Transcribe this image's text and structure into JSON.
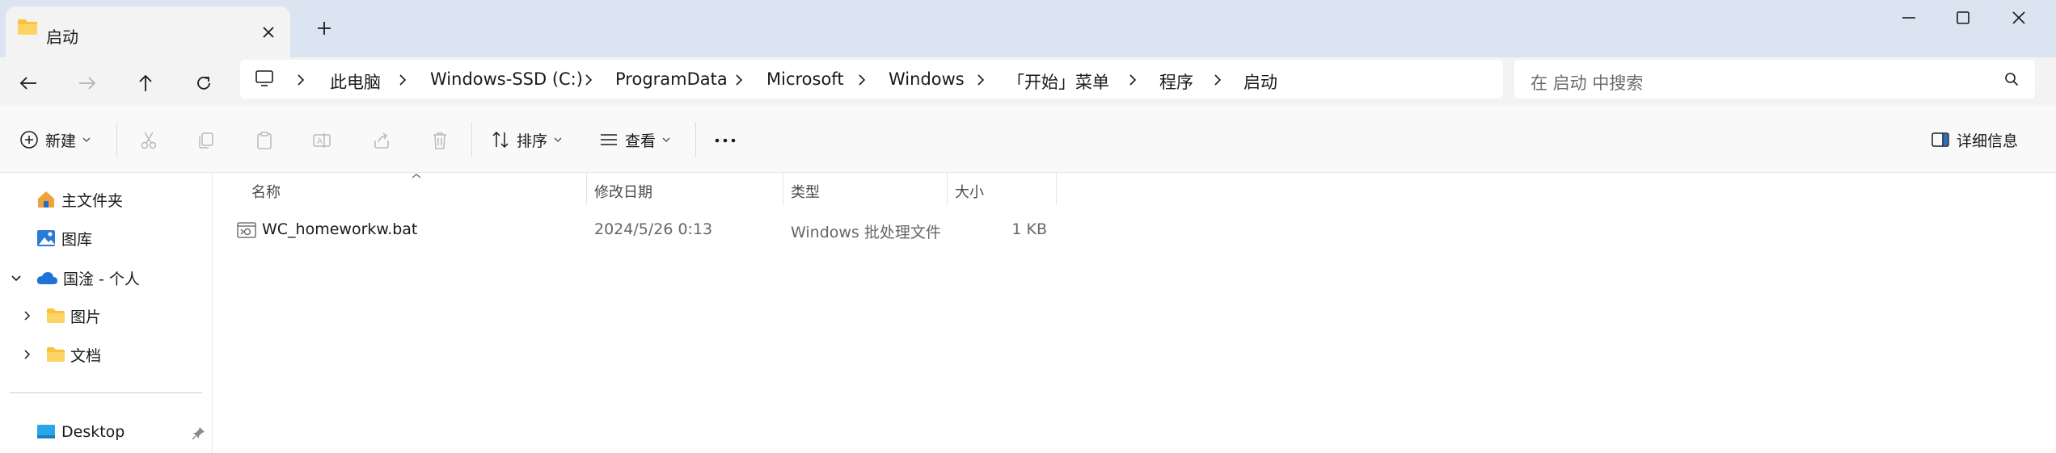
{
  "colors": {
    "titlebar_bg": "#dbe4f1",
    "tab_bg": "#f3f3f3",
    "folder_yellow": "#f8c23c",
    "onedrive_blue": "#1f73d6",
    "accent": "#2b6cc4"
  },
  "tab": {
    "title": "启动",
    "icon": "folder-icon",
    "close_icon": "close-icon"
  },
  "window": {
    "minimize_icon": "minimize-icon",
    "maximize_icon": "maximize-icon",
    "close_icon": "close-icon"
  },
  "nav": {
    "back_icon": "back-arrow-icon",
    "forward_icon": "forward-arrow-icon",
    "up_icon": "up-arrow-icon",
    "refresh_icon": "refresh-icon"
  },
  "breadcrumb": [
    "此电脑",
    "Windows-SSD (C:)",
    "ProgramData",
    "Microsoft",
    "Windows",
    "「开始」菜单",
    "程序",
    "启动"
  ],
  "search": {
    "placeholder": "在 启动 中搜索",
    "icon": "search-icon"
  },
  "commands": {
    "new_label": "新建",
    "sort_label": "排序",
    "view_label": "查看",
    "details_label": "详细信息",
    "icons": [
      "cut-icon",
      "copy-icon",
      "paste-icon",
      "rename-icon",
      "share-icon",
      "delete-icon",
      "more-icon"
    ]
  },
  "sidebar": {
    "items": [
      {
        "label": "主文件夹",
        "icon": "home-icon"
      },
      {
        "label": "图库",
        "icon": "gallery-icon"
      },
      {
        "label": "国淦 - 个人",
        "icon": "onedrive-icon"
      },
      {
        "label": "图片",
        "icon": "folder-icon"
      },
      {
        "label": "文档",
        "icon": "folder-icon"
      },
      {
        "label": "Desktop",
        "icon": "desktop-icon"
      }
    ]
  },
  "columns": {
    "name": "名称",
    "modified": "修改日期",
    "type": "类型",
    "size": "大小"
  },
  "files": [
    {
      "name": "WC_homeworkw.bat",
      "modified": "2024/5/26 0:13",
      "type": "Windows 批处理文件",
      "size": "1 KB",
      "icon": "batch-file-icon"
    }
  ]
}
